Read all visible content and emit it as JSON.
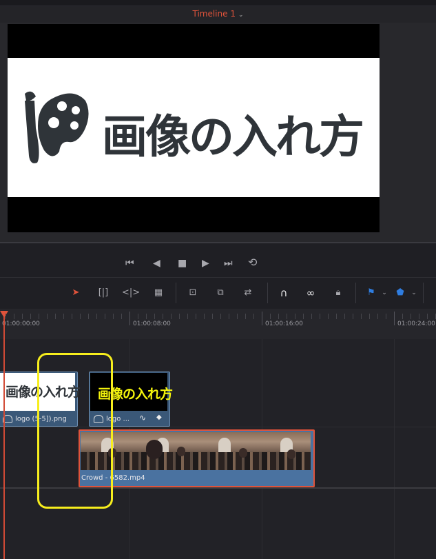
{
  "header": {
    "timeline_title": "Timeline 1"
  },
  "viewer": {
    "logo_text": "画像の入れ方"
  },
  "ruler": {
    "timecodes": [
      "01:00:00:00",
      "01:00:08:00",
      "01:00:16:00",
      "01:00:24:00"
    ]
  },
  "clips": [
    {
      "name": "logo (5-5]).png",
      "thumb_text": "画像の入れ方",
      "thumb_color": "#ffffff"
    },
    {
      "name": "logo ...",
      "thumb_text": "画像の入れ方",
      "thumb_color": "#f5f50c"
    },
    {
      "name": "Crowd - 6582.mp4"
    }
  ],
  "colors": {
    "accent": "#e0533b",
    "highlight": "#f7ee1d",
    "clip_blue": "#3a5878"
  }
}
